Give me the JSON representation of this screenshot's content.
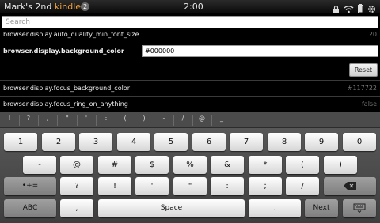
{
  "status_bar": {
    "device_prefix": "Mark's 2nd ",
    "device_brand": "kindle",
    "notification_count": "2",
    "time": "2:00",
    "icons": [
      "lock-icon",
      "wifi-icon",
      "battery-icon",
      "settings-icon"
    ]
  },
  "search": {
    "placeholder": "Search"
  },
  "prefs": [
    {
      "name": "browser.display.auto_quality_min_font_size",
      "value": "20"
    },
    {
      "name": "browser.display.background_color",
      "value": "#000000"
    },
    {
      "name": "browser.display.focus_background_color",
      "value": "#117722"
    },
    {
      "name": "browser.display.focus_ring_on_anything",
      "value": "false"
    }
  ],
  "reset_label": "Reset",
  "keyboard": {
    "strip": [
      "!",
      "?",
      ",",
      "\"",
      "'",
      ":",
      "(",
      ")",
      "-",
      "/",
      "@",
      "_"
    ],
    "row1": [
      "1",
      "2",
      "3",
      "4",
      "5",
      "6",
      "7",
      "8",
      "9",
      "0"
    ],
    "row2": [
      "-",
      "@",
      "#",
      "$",
      "%",
      "&",
      "*",
      "(",
      ")"
    ],
    "row3": [
      "•+=",
      "?",
      "!",
      "'",
      "\"",
      ":",
      ";",
      "/"
    ],
    "abc_label": "ABC",
    "comma_label": ",",
    "space_label": "Space",
    "period_label": ".",
    "next_label": "Next"
  },
  "colors": {
    "brand_orange": "#f4a23a",
    "background": "#000000"
  }
}
